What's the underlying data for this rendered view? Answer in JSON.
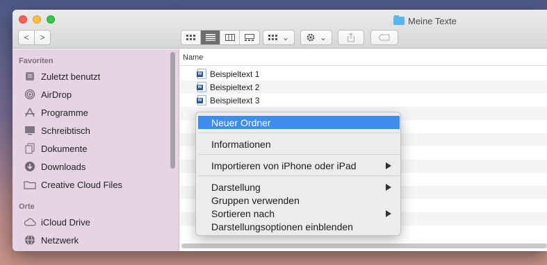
{
  "window": {
    "title": "Meine Texte"
  },
  "toolbar": {
    "back": "<",
    "forward": ">",
    "arrange_chevron": "⌄",
    "action_chevron": "⌄"
  },
  "sidebar": {
    "favorites_header": "Favoriten",
    "favorites": [
      {
        "label": "Zuletzt benutzt",
        "icon": "recents-icon"
      },
      {
        "label": "AirDrop",
        "icon": "airdrop-icon"
      },
      {
        "label": "Programme",
        "icon": "applications-icon"
      },
      {
        "label": "Schreibtisch",
        "icon": "desktop-icon"
      },
      {
        "label": "Dokumente",
        "icon": "documents-icon"
      },
      {
        "label": "Downloads",
        "icon": "downloads-icon"
      },
      {
        "label": "Creative Cloud Files",
        "icon": "folder-icon"
      }
    ],
    "places_header": "Orte",
    "places": [
      {
        "label": "iCloud Drive",
        "icon": "cloud-icon"
      },
      {
        "label": "Netzwerk",
        "icon": "network-icon"
      }
    ]
  },
  "list": {
    "column_name": "Name",
    "files": [
      "Beispieltext 1",
      "Beispieltext 2",
      "Beispieltext 3"
    ]
  },
  "context_menu": {
    "new_folder": "Neuer Ordner",
    "get_info": "Informationen",
    "import_iphone": "Importieren von iPhone oder iPad",
    "view": "Darstellung",
    "use_groups": "Gruppen verwenden",
    "sort_by": "Sortieren nach",
    "show_view_options": "Darstellungsoptionen einblenden"
  },
  "colors": {
    "accent": "#3d8cf0",
    "sidebar": "#e6d3e4"
  }
}
